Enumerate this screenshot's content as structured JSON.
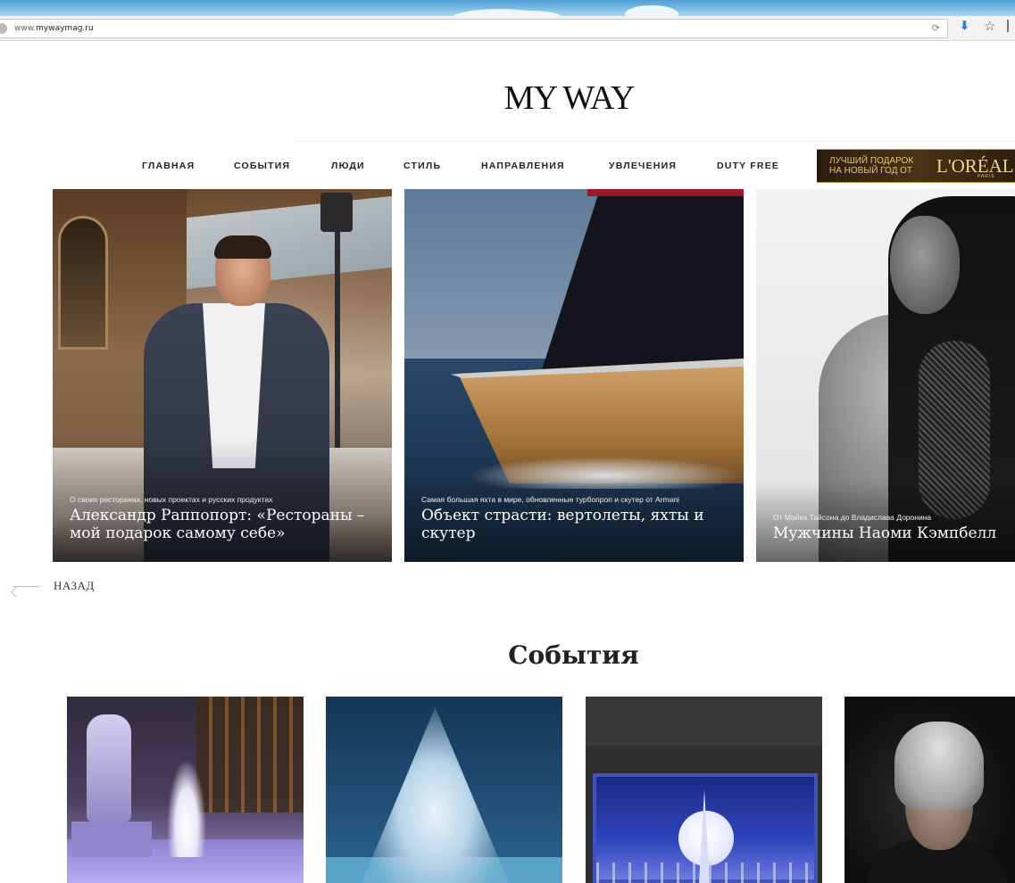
{
  "browser": {
    "url_prefix": "www.",
    "url_domain": "mywaymag.ru"
  },
  "site": {
    "logo": "MY WAY"
  },
  "nav": {
    "items": [
      {
        "label": "ГЛАВНАЯ"
      },
      {
        "label": "СОБЫТИЯ"
      },
      {
        "label": "ЛЮДИ"
      },
      {
        "label": "СТИЛЬ"
      },
      {
        "label": "НАПРАВЛЕНИЯ"
      },
      {
        "label": "УВЛЕЧЕНИЯ"
      },
      {
        "label": "DUTY FREE"
      }
    ]
  },
  "ad": {
    "text": "ЛУЧШИЙ ПОДАРОК\nНА НОВЫЙ ГОД ОТ",
    "brand": "L'ORÉAL",
    "brand_sub": "PARIS"
  },
  "slides": [
    {
      "kicker": "О своих ресторанах, новых проектах и русских продуктах",
      "headline": "Александр Раппопорт: «Рестораны – мой подарок самому себе»"
    },
    {
      "kicker": "Самая большая яхта в мире, обновленные турбопроп и скутер от Armani",
      "headline": "Объект страсти: вертолеты, яхты и скутер"
    },
    {
      "kicker": "От Майка Тайсона до Владислава Доронина",
      "headline": "Мужчины Наоми Кэмпбелл"
    }
  ],
  "back": {
    "label": "НАЗАД"
  },
  "events": {
    "title": "События"
  },
  "colors": {
    "ad_gold": "#e2c47a",
    "ad_background": "#2a1c0c",
    "download_blue": "#2a7fd4"
  },
  "icons": {
    "reload": "reload-icon",
    "download": "download-arrow-icon",
    "bookmark": "star-icon",
    "back": "arrow-left-icon"
  }
}
